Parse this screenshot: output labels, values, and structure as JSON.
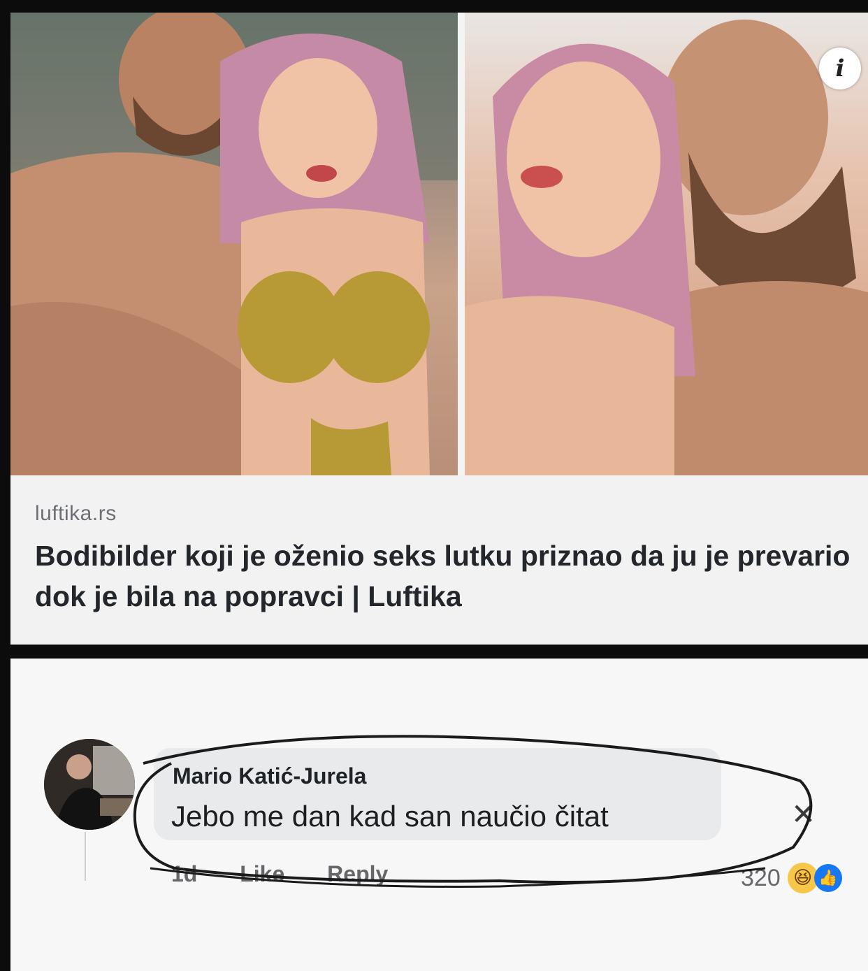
{
  "link_preview": {
    "info_badge": "i",
    "domain": "luftika.rs",
    "headline": "Bodibilder koji je oženio seks lutku priznao da ju je prevario dok je bila na popravci | Luftika"
  },
  "comment": {
    "author": "Mario Katić-Jurela",
    "text": "Jebo me dan kad san naučio čitat",
    "time": "1d",
    "like_label": "Like",
    "reply_label": "Reply",
    "reaction_count": "320",
    "close_glyph": "✕"
  },
  "colors": {
    "headline": "#23262b",
    "domain": "#6c6f74",
    "bubble": "#e9eaeb",
    "like_blue": "#1877f2",
    "haha_yellow": "#f7c74a"
  }
}
